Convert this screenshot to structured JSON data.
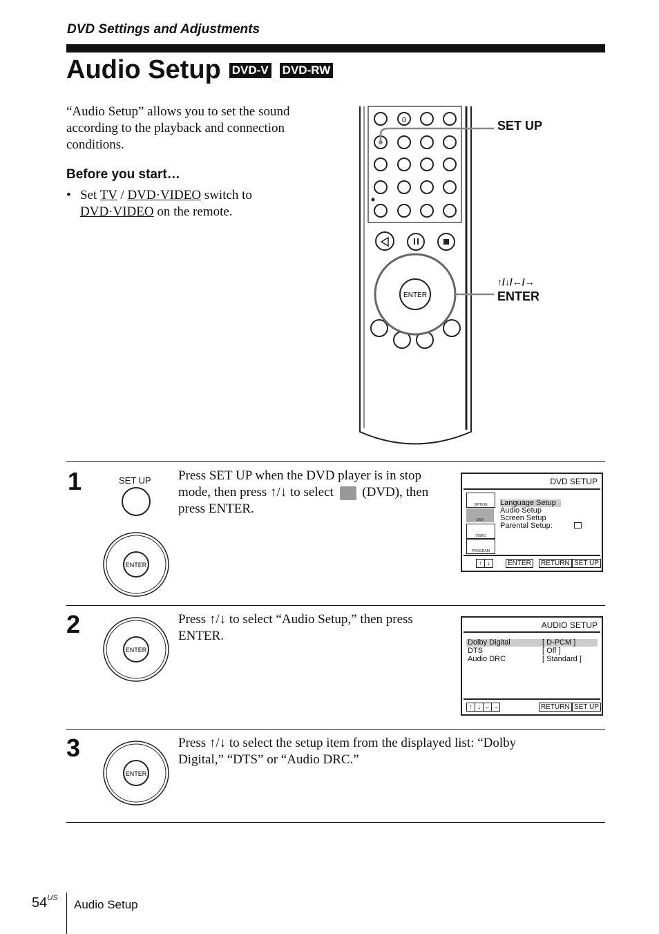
{
  "header": {
    "section": "DVD Settings and Adjustments",
    "title": "Audio Setup",
    "badges": [
      "DVD-V",
      "DVD-RW"
    ]
  },
  "intro": {
    "text": "“Audio Setup” allows you to set the sound according to the playback and connection conditions.",
    "before_heading": "Before you start…",
    "bullet": {
      "pre": "Set ",
      "tv": "TV",
      "sep": " / ",
      "dvd_video_1": "DVD·VIDEO",
      "mid": " switch to ",
      "dvd_video_2": "DVD·VIDEO",
      "post": " on the remote."
    }
  },
  "remote": {
    "callout_setup": "SET UP",
    "callout_arrows": "↑/↓/←/→",
    "callout_enter": "ENTER",
    "zero_label": "0",
    "enter_label": "ENTER"
  },
  "steps": [
    {
      "number": "1",
      "button_label": "SET UP",
      "text_a": "Press SET UP when the DVD player is in stop mode, then press ↑/↓ to select",
      "text_b": "(DVD), then press ENTER.",
      "osd": {
        "title": "DVD SETUP",
        "icons": [
          "OPTION",
          "DVD",
          "VIDEO",
          "PROGRAM"
        ],
        "selected_icon": "DVD",
        "menu": [
          "Language Setup",
          "Audio Setup",
          "Screen Setup",
          "Parental Setup:"
        ],
        "highlighted": "Language Setup",
        "nav": [
          "↑",
          "↓"
        ],
        "buttons": [
          "ENTER",
          "RETURN",
          "SET UP"
        ]
      }
    },
    {
      "number": "2",
      "text": "Press ↑/↓ to select “Audio Setup,” then press ENTER.",
      "osd": {
        "title": "AUDIO SETUP",
        "rows": [
          {
            "label": "Dolby Digital",
            "value": "[ D-PCM ]"
          },
          {
            "label": "DTS",
            "value": "[ Off ]"
          },
          {
            "label": "Audio DRC",
            "value": "[ Standard ]"
          }
        ],
        "highlighted": "Dolby Digital",
        "nav": [
          "↑",
          "↓",
          "←",
          "→"
        ],
        "buttons": [
          "RETURN",
          "SET UP"
        ]
      }
    },
    {
      "number": "3",
      "text": "Press ↑/↓ to select the setup item from the displayed list: “Dolby Digital,” “DTS” or “Audio DRC.”"
    }
  ],
  "footer": {
    "page": "54",
    "region": "US",
    "label": "Audio Setup"
  }
}
